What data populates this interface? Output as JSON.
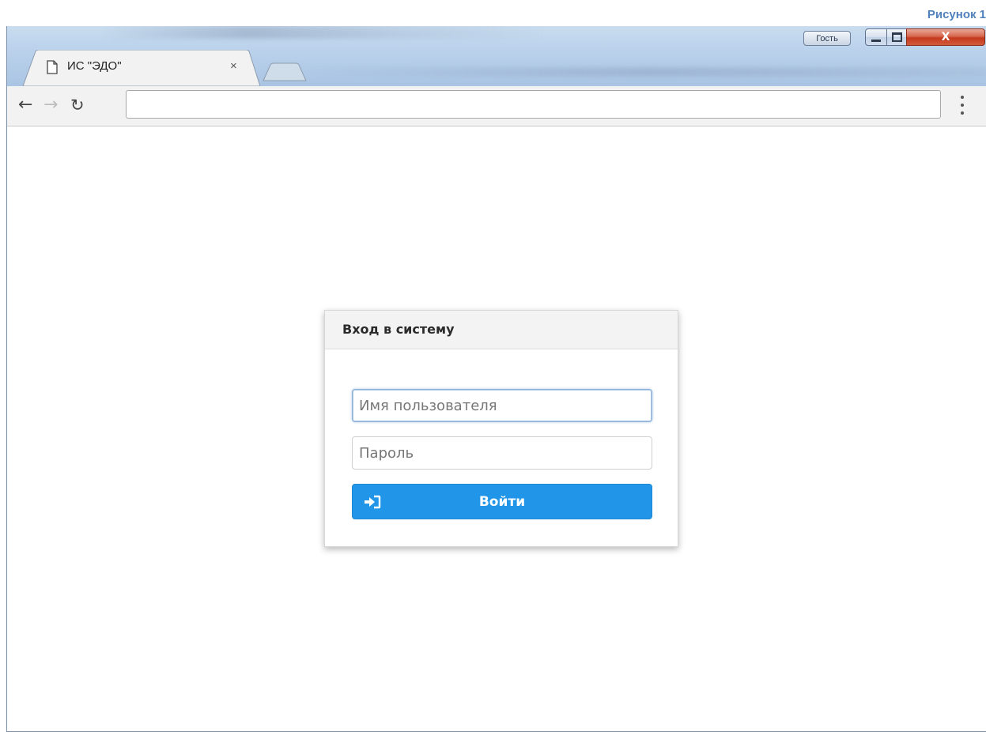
{
  "caption": "Рисунок 1",
  "window": {
    "guest_label": "Гость",
    "controls": {
      "close_glyph": "X"
    }
  },
  "tab": {
    "title": "ИС \"ЭДО\"",
    "close_glyph": "×",
    "icon": "page-icon"
  },
  "toolbar": {
    "back_glyph": "←",
    "forward_glyph": "→",
    "reload_glyph": "↻",
    "address_value": ""
  },
  "login": {
    "title": "Вход в систему",
    "username_placeholder": "Имя пользователя",
    "password_placeholder": "Пароль",
    "submit_label": "Войти",
    "submit_icon": "sign-in-icon"
  },
  "colors": {
    "accent": "#2196e8",
    "caption": "#4f81bd",
    "close_button": "#c4391c"
  }
}
